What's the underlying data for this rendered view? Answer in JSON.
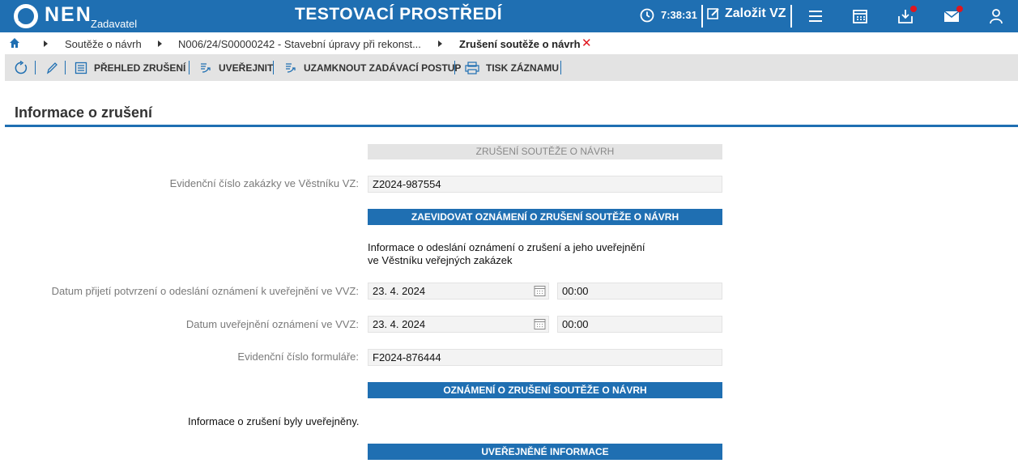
{
  "app": {
    "logo_text": "NEN",
    "logo_subtitle": "Zadavatel",
    "environment_title": "TESTOVACÍ PROSTŘEDÍ",
    "time": "7:38:31",
    "create_button_label": "Založit VZ",
    "brand_color": "#1f6fb2",
    "notification_color": "#e0161e"
  },
  "breadcrumb": {
    "items": [
      "Soutěže o návrh",
      "N006/24/S00000242 - Stavební úpravy při rekonst...",
      "Zrušení soutěže o návrh"
    ]
  },
  "toolbar": {
    "overview_label": "PŘEHLED ZRUŠENÍ",
    "publish_label": "UVEŘEJNIT",
    "lock_label": "UZAMKNOUT ZADÁVACÍ POSTUP",
    "print_label": "TISK ZÁZNAMU"
  },
  "section": {
    "title": "Informace o zrušení"
  },
  "form": {
    "header": "ZRUŠENÍ SOUTĚŽE O NÁVRH",
    "evidence_number_label": "Evidenční číslo zakázky ve Věstníku VZ:",
    "evidence_number_value": "Z2024-987554",
    "register_button": "ZAEVIDOVAT OZNÁMENÍ O ZRUŠENÍ SOUTĚŽE O NÁVRH",
    "info_line1": "Informace o odeslání oznámení o zrušení a jeho uveřejnění",
    "info_line2": "ve Věstníku veřejných zakázek",
    "receipt_date_label": "Datum přijetí potvrzení o odeslání oznámení k uveřejnění ve VVZ:",
    "receipt_date_value": "23. 4. 2024",
    "receipt_time_value": "00:00",
    "publish_date_label": "Datum uveřejnění oznámení ve VVZ:",
    "publish_date_value": "23. 4. 2024",
    "publish_time_value": "00:00",
    "form_number_label": "Evidenční číslo formuláře:",
    "form_number_value": "F2024-876444",
    "notice_button": "OZNÁMENÍ O ZRUŠENÍ SOUTĚŽE O NÁVRH",
    "status_text": "Informace o zrušení byly uveřejněny.",
    "published_info_button": "UVEŘEJNĚNÉ INFORMACE"
  }
}
